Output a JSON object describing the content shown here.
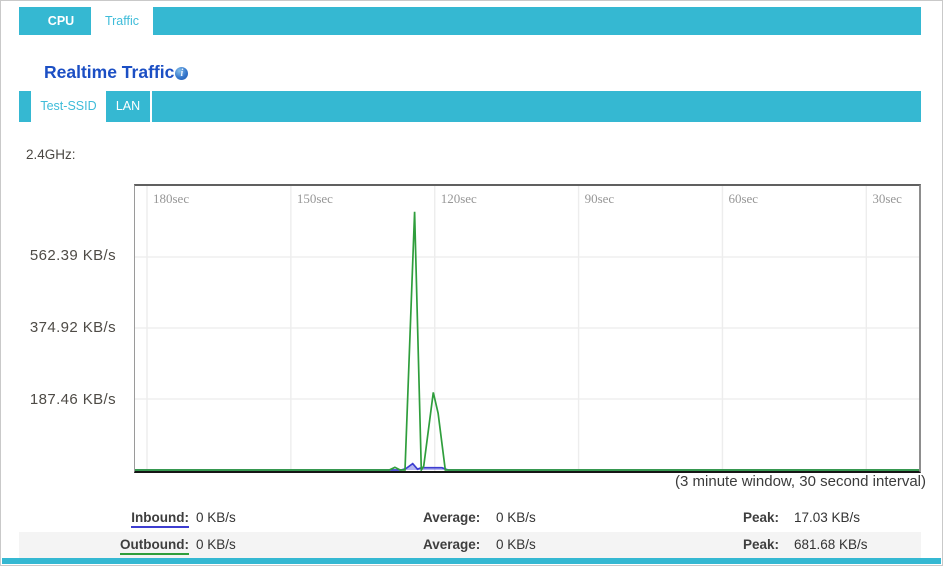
{
  "page": {
    "accent_teal": "#35b8d2"
  },
  "top_tabs": {
    "items": [
      {
        "label": "CPU",
        "active": false
      },
      {
        "label": "Traffic",
        "active": true
      }
    ]
  },
  "header": {
    "title": "Realtime Traffic",
    "info_icon_glyph": "i"
  },
  "sub_tabs": {
    "items": [
      {
        "label": "Test-SSID",
        "active": true
      },
      {
        "label": "LAN",
        "active": false
      }
    ]
  },
  "band_label": "2.4GHz:",
  "chart_data": {
    "type": "line",
    "title": "Realtime Traffic - 2.4GHz",
    "x_axis": {
      "tick_values": [
        180,
        150,
        120,
        90,
        60,
        30
      ],
      "tick_labels": [
        "180sec",
        "150sec",
        "120sec",
        "90sec",
        "60sec",
        "30sec"
      ],
      "unit": "seconds ago (newest at right)",
      "window_note": "(3 minute window, 30 second interval)"
    },
    "y_axis": {
      "tick_values": [
        562.39,
        374.92,
        187.46
      ],
      "tick_labels": [
        "562.39 KB/s",
        "374.92 KB/s",
        "187.46 KB/s"
      ],
      "ylim": [
        0,
        749.85
      ],
      "unit": "KB/s"
    },
    "grid": true,
    "series": [
      {
        "name": "Inbound",
        "color": "#3d3dd0",
        "fill": "rgba(90,90,225,0.45)",
        "points": [
          [
            183,
            0
          ],
          [
            127,
            0
          ],
          [
            126,
            4
          ],
          [
            124.6,
            17.03
          ],
          [
            123.6,
            2
          ],
          [
            122.8,
            6
          ],
          [
            118.5,
            6
          ],
          [
            117.2,
            0
          ],
          [
            19,
            0
          ]
        ]
      },
      {
        "name": "Outbound",
        "color": "#2f9e3c",
        "fill": "none",
        "points": [
          [
            183,
            0
          ],
          [
            129.5,
            0
          ],
          [
            128.3,
            7
          ],
          [
            127.2,
            0
          ],
          [
            126.2,
            0
          ],
          [
            124.2,
            681.68
          ],
          [
            122.8,
            0
          ],
          [
            122.3,
            10
          ],
          [
            120.3,
            205
          ],
          [
            119.3,
            150
          ],
          [
            117.8,
            0
          ],
          [
            19,
            0
          ]
        ]
      }
    ]
  },
  "caption": "(3 minute window, 30 second interval)",
  "stats": {
    "rows": [
      {
        "label": "Inbound:",
        "underline": "#3d3dd0",
        "value": "0 KB/s",
        "avg_label": "Average:",
        "avg_value": "0 KB/s",
        "peak_label": "Peak:",
        "peak_value": "17.03 KB/s"
      },
      {
        "label": "Outbound:",
        "underline": "#2f9e3c",
        "value": "0 KB/s",
        "avg_label": "Average:",
        "avg_value": "0 KB/s",
        "peak_label": "Peak:",
        "peak_value": "681.68 KB/s"
      }
    ]
  }
}
